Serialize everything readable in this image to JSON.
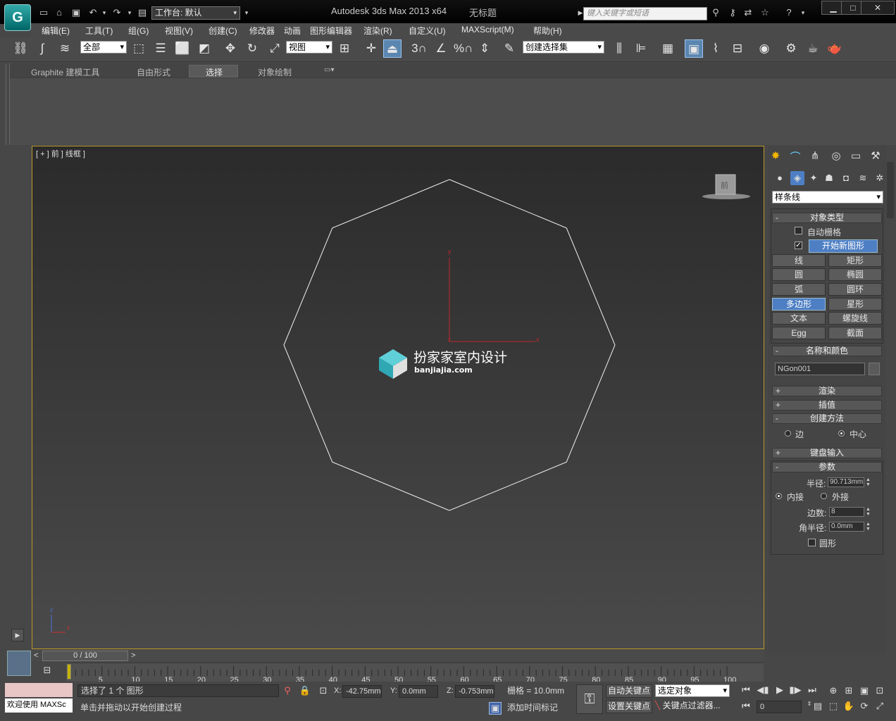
{
  "titlebar": {
    "workspace_label": "工作台: 默认",
    "app_title": "Autodesk 3ds Max  2013 x64",
    "document_title": "无标题",
    "search_placeholder": "键入关键字或短语"
  },
  "menu": [
    "编辑(E)",
    "工具(T)",
    "组(G)",
    "视图(V)",
    "创建(C)",
    "修改器",
    "动画",
    "图形编辑器",
    "渲染(R)",
    "自定义(U)",
    "MAXScript(M)",
    "帮助(H)"
  ],
  "toolbar": {
    "selection_filter": "全部",
    "ref_coord": "视图",
    "named_sel": "创建选择集",
    "snap_3": "3",
    "percent": "%"
  },
  "ribbon": {
    "tabs": [
      "Graphite 建模工具",
      "自由形式",
      "选择",
      "对象绘制"
    ],
    "active_tab": "选择"
  },
  "viewport": {
    "label": "[ + ] 前 ] 线框 ]",
    "axis_y": "y",
    "axis_x": "x",
    "axis_z": "z",
    "viewcube_label": "前",
    "watermark_name": "扮家家室内设计",
    "watermark_url": "banjiajia.com",
    "shape_sides": 8
  },
  "command_panel": {
    "category": "样条线",
    "object_type_title": "对象类型",
    "auto_grid": "自动栅格",
    "start_new_shape": "开始新图形",
    "buttons": [
      [
        "线",
        "矩形"
      ],
      [
        "圆",
        "椭圆"
      ],
      [
        "弧",
        "圆环"
      ],
      [
        "多边形",
        "星形"
      ],
      [
        "文本",
        "螺旋线"
      ],
      [
        "Egg",
        "截面"
      ]
    ],
    "selected_button": "多边形",
    "name_color_title": "名称和颜色",
    "object_name": "NGon001",
    "rollouts_collapsed": [
      "渲染",
      "插值"
    ],
    "creation_method_title": "创建方法",
    "creation_edge": "边",
    "creation_center": "中心",
    "keyboard_title": "键盘输入",
    "params_title": "参数",
    "radius_label": "半径:",
    "radius_value": "90.713mm",
    "inscribed": "内接",
    "circumscribed": "外接",
    "sides_label": "边数:",
    "sides_value": "8",
    "corner_label": "角半径:",
    "corner_value": "0.0mm",
    "circular": "圆形",
    "pm_minus": "-",
    "pm_plus": "+"
  },
  "timeline": {
    "frame_display": "0 / 100",
    "ticks": [
      "5",
      "10",
      "15",
      "20",
      "25",
      "30",
      "35",
      "40",
      "45",
      "50",
      "55",
      "60",
      "65",
      "70",
      "75",
      "80",
      "85",
      "90",
      "95",
      "100"
    ],
    "prev": "<",
    "next": ">"
  },
  "status": {
    "maxscript_hint": "欢迎使用 MAXSc",
    "selected_text": "选择了 1 个 图形",
    "prompt_text": "单击并拖动以开始创建过程",
    "x_label": "X:",
    "x_value": "-42.75mm",
    "y_label": "Y:",
    "y_value": "0.0mm",
    "z_label": "Z:",
    "z_value": "-0.753mm",
    "grid": "栅格 = 10.0mm",
    "add_time_tag": "添加时间标记",
    "auto_key": "自动关键点",
    "set_key": "设置关键点",
    "key_mode": "选定对象",
    "key_filters": "关键点过滤器...",
    "frame_field": "0"
  }
}
